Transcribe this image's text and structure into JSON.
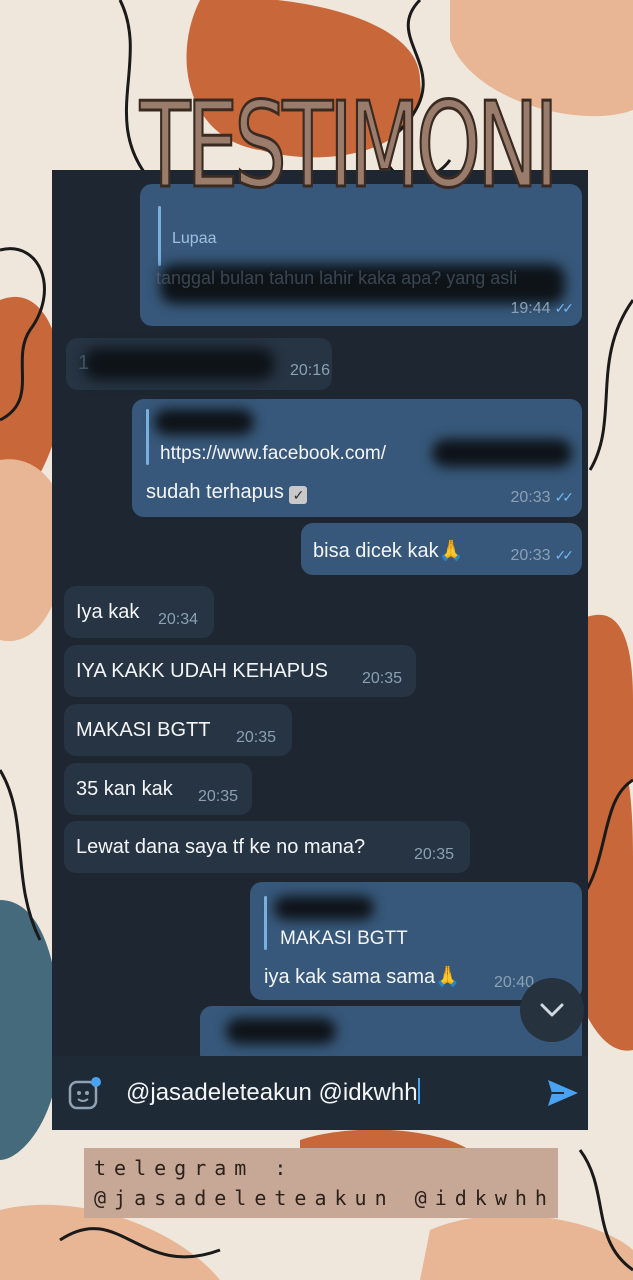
{
  "title": "TESTIMONI",
  "messages": {
    "m1": {
      "reply_to": "Lupaa",
      "text": "tanggal bulan tahun lahir kaka apa? yang asli",
      "time": "19:44"
    },
    "m2": {
      "text": "1",
      "time": "20:16"
    },
    "m3": {
      "link": "https://www.facebook.com/",
      "text": "sudah terhapus",
      "time": "20:33"
    },
    "m4": {
      "text": "bisa dicek kak",
      "emoji": "🙏",
      "time": "20:33"
    },
    "m5": {
      "text": "Iya kak",
      "time": "20:34"
    },
    "m6": {
      "text": "IYA KAKK UDAH KEHAPUS",
      "time": "20:35"
    },
    "m7": {
      "text": "MAKASI BGTT",
      "time": "20:35"
    },
    "m8": {
      "text": "35 kan kak",
      "time": "20:35"
    },
    "m9": {
      "text": "Lewat dana saya tf ke no mana?",
      "time": "20:35"
    },
    "m10": {
      "reply_to": "MAKASI BGTT",
      "text": "iya kak sama sama",
      "emoji": "🙏",
      "time": "20:40"
    }
  },
  "input": {
    "value": "@jasadeleteakun @idkwhh"
  },
  "footer": {
    "line1": "telegram :",
    "line2": "@jasadeleteakun @idkwhh"
  },
  "colors": {
    "chat_bg": "#1d2631",
    "incoming": "#263443",
    "outgoing": "#37587a",
    "accent": "#4aa3f0"
  }
}
